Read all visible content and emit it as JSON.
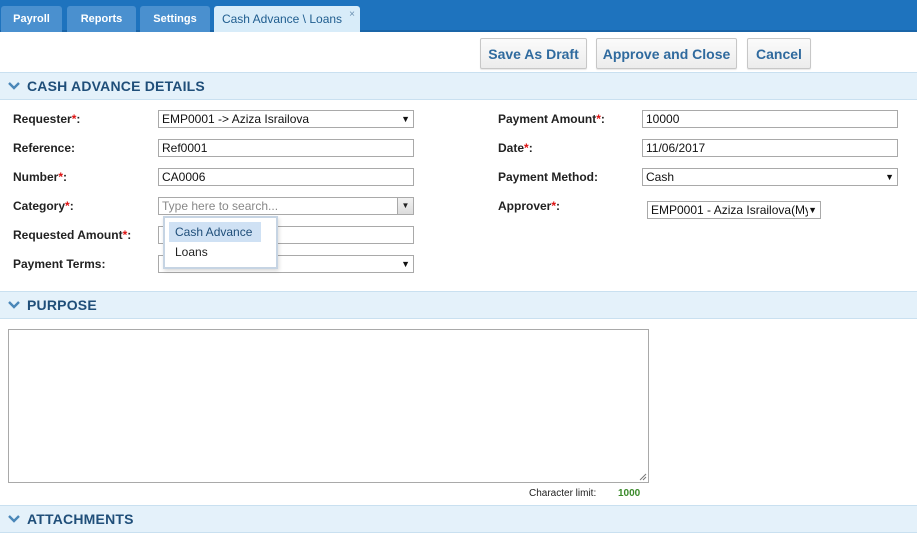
{
  "tabs": [
    {
      "label": "Payroll"
    },
    {
      "label": "Reports"
    },
    {
      "label": "Settings"
    },
    {
      "label": "Cash Advance \\ Loans",
      "close": "×"
    }
  ],
  "toolbar": {
    "save_draft": "Save As Draft",
    "approve_close": "Approve and Close",
    "cancel": "Cancel"
  },
  "sections": {
    "details": "CASH ADVANCE DETAILS",
    "purpose": "PURPOSE",
    "attachments": "ATTACHMENTS"
  },
  "required_mark": "*",
  "form": {
    "requester": {
      "label": "Requester",
      "value": "EMP0001 -> Aziza Israilova"
    },
    "reference": {
      "label": "Reference:",
      "value": "Ref0001"
    },
    "number": {
      "label": "Number",
      "value": "CA0006"
    },
    "category": {
      "label": "Category",
      "placeholder": "Type here to search...",
      "options": [
        "Cash Advance",
        "Loans"
      ]
    },
    "requested_amount": {
      "label": "Requested Amount",
      "value": ""
    },
    "payment_terms": {
      "label": "Payment Terms:",
      "value": ""
    },
    "payment_amount": {
      "label": "Payment Amount",
      "value": "10000"
    },
    "date": {
      "label": "Date",
      "value": "11/06/2017"
    },
    "payment_method": {
      "label": "Payment Method:",
      "value": "Cash"
    },
    "approver": {
      "label": "Approver",
      "value": "EMP0001 - Aziza Israilova(My"
    }
  },
  "purpose": {
    "text": "",
    "char_limit_label": "Character limit:",
    "char_limit_value": "1000"
  },
  "colors": {
    "tabbar": "#1e73be",
    "section_bg": "#e4f1fa",
    "button_text": "#2f6a9e",
    "required": "#dd1111"
  }
}
